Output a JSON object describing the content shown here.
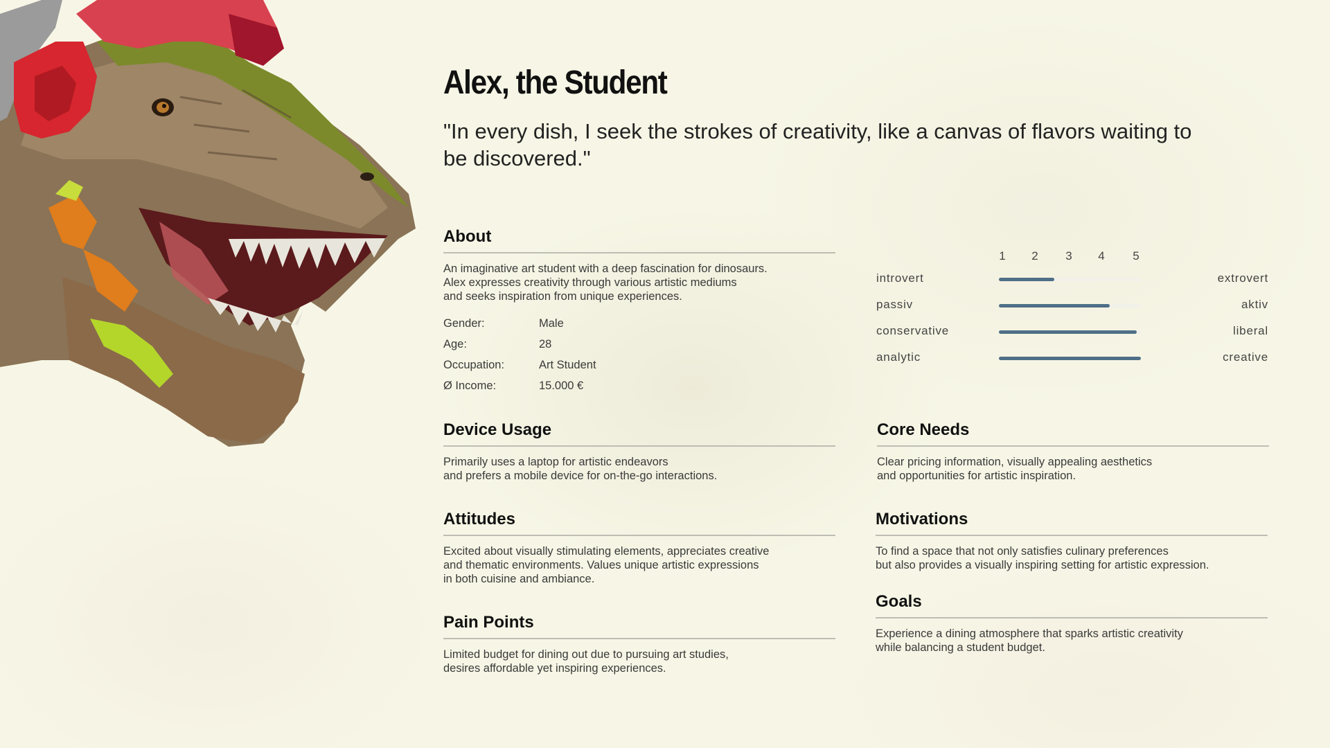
{
  "persona": {
    "name": "Alex, the Student",
    "quote": "\"In every dish, I seek the strokes of creativity, like a canvas of flavors waiting to be discovered.\""
  },
  "about": {
    "heading": "About",
    "text": "An imaginative art student with a deep fascination for dinosaurs.\nAlex expresses creativity through various artistic mediums\nand seeks inspiration from unique experiences.",
    "details": [
      {
        "label": "Gender:",
        "value": "Male"
      },
      {
        "label": "Age:",
        "value": "28"
      },
      {
        "label": "Occupation:",
        "value": "Art Student"
      },
      {
        "label": "Ø Income:",
        "value": "15.000 €"
      }
    ]
  },
  "traits": {
    "scale": [
      "1",
      "2",
      "3",
      "4",
      "5"
    ],
    "rows": [
      {
        "left": "introvert",
        "right": "extrovert",
        "level": 0.39
      },
      {
        "left": "passiv",
        "right": "aktiv",
        "level": 0.78
      },
      {
        "left": "conservative",
        "right": "liberal",
        "level": 0.97
      },
      {
        "left": "analytic",
        "right": "creative",
        "level": 1.0
      }
    ],
    "bar_color": "#4f6f87"
  },
  "device_usage": {
    "heading": "Device Usage",
    "text": "Primarily uses a laptop for artistic endeavors\nand prefers a mobile device for on-the-go interactions."
  },
  "core_needs": {
    "heading": "Core Needs",
    "text": "Clear pricing information, visually appealing aesthetics\nand opportunities for artistic inspiration."
  },
  "attitudes": {
    "heading": "Attitudes",
    "text": "Excited about visually stimulating elements, appreciates creative\nand thematic environments. Values unique artistic expressions\nin both cuisine and ambiance."
  },
  "motivations": {
    "heading": "Motivations",
    "text": "To find a space that not only satisfies culinary preferences\nbut also provides a visually inspiring setting for artistic expression."
  },
  "goals": {
    "heading": "Goals",
    "text": "Experience a dining atmosphere that sparks artistic creativity\nwhile balancing a student budget."
  },
  "pain_points": {
    "heading": "Pain Points",
    "text": "Limited budget for dining out due to pursuing art studies,\ndesires affordable yet inspiring experiences."
  }
}
